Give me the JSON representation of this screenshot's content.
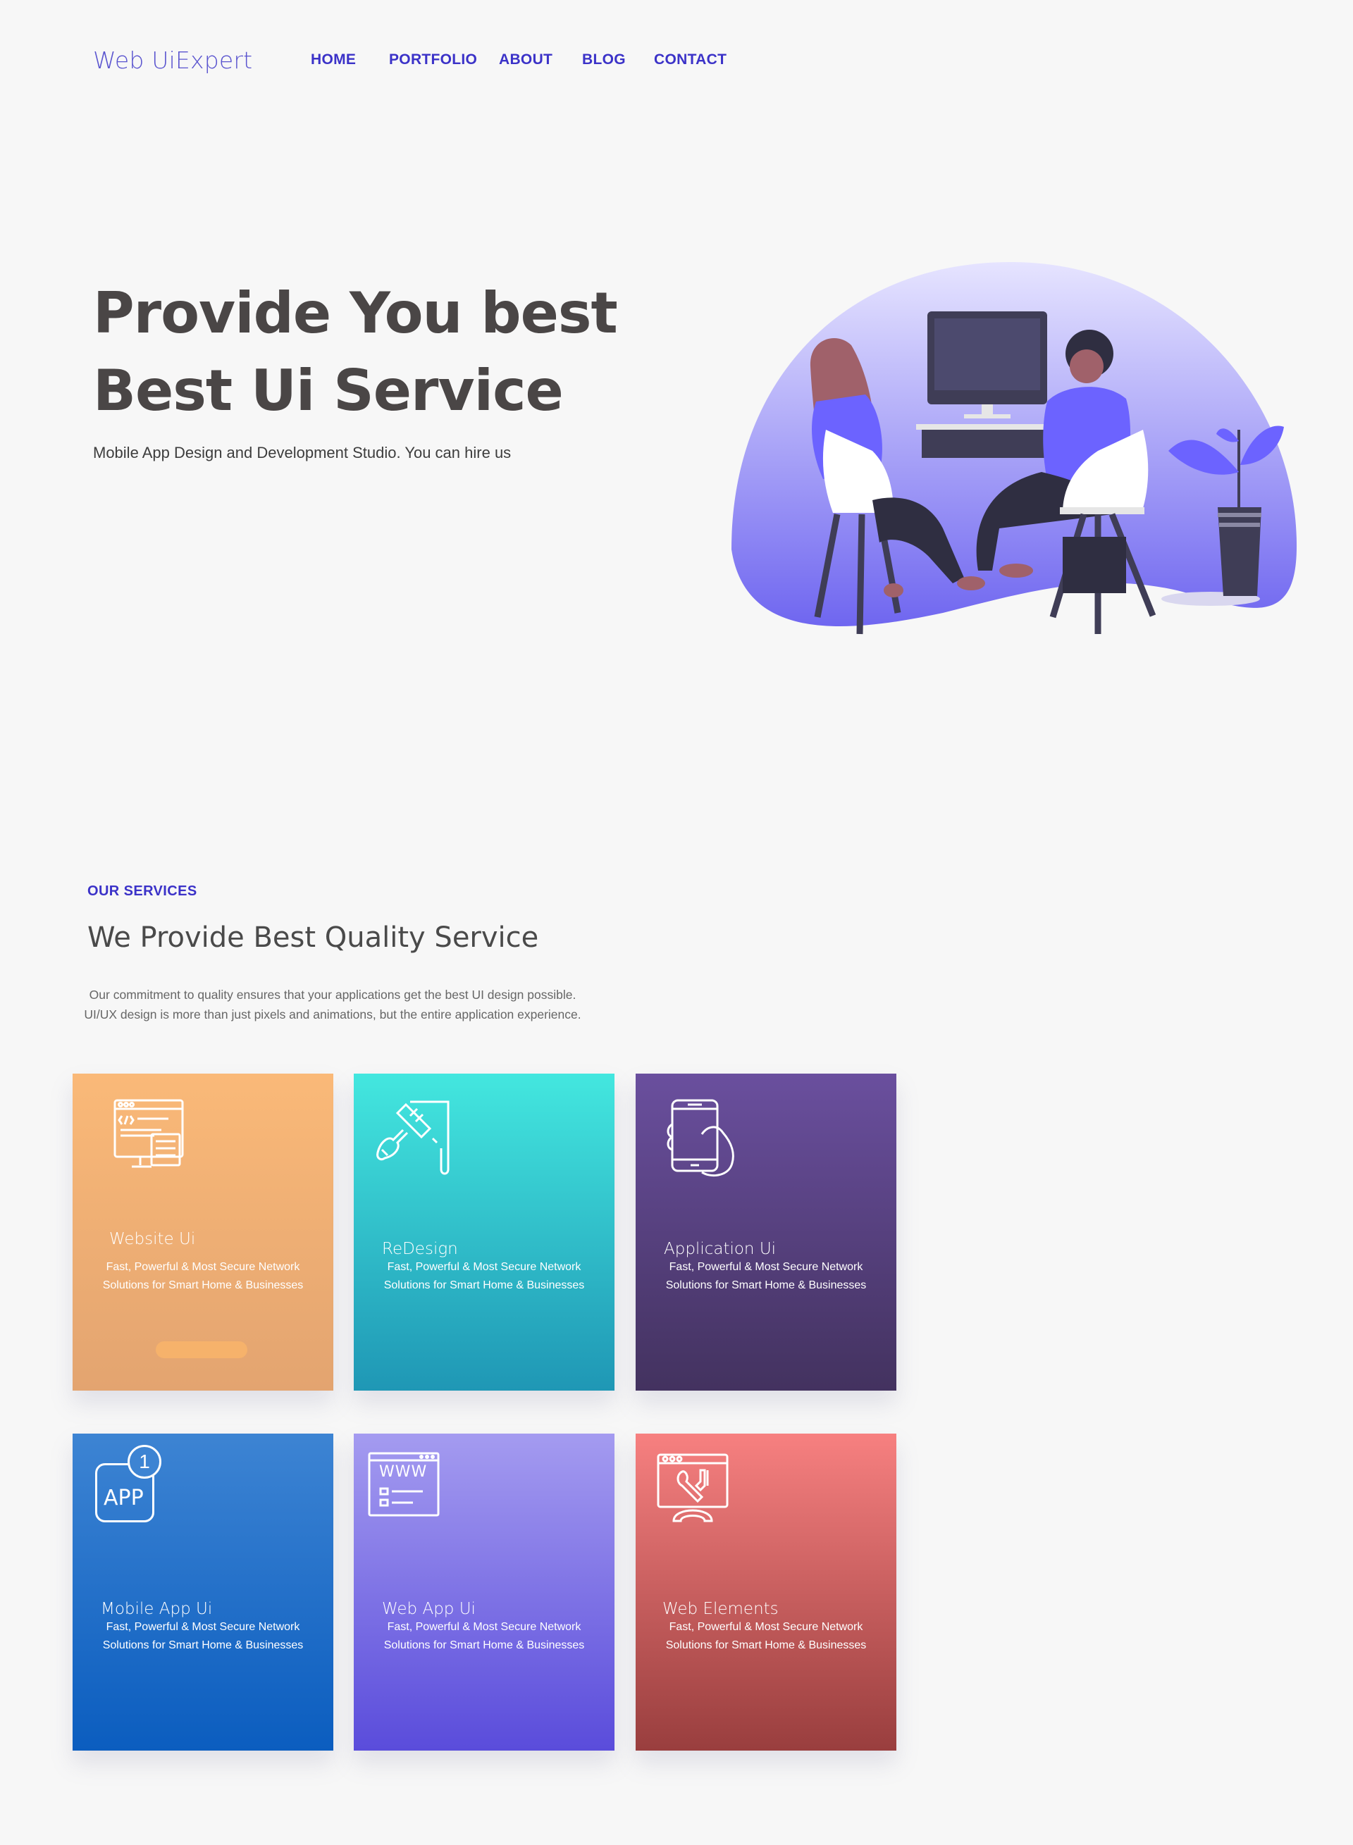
{
  "nav": {
    "logo": "Web UiExpert",
    "links": [
      "HOME",
      "PORTFOLIO",
      "ABOUT",
      "BLOG",
      "CONTACT"
    ]
  },
  "hero": {
    "title_line1": "Provide You best",
    "title_line2": "Best Ui Service",
    "subtitle": "Mobile App Design and Development Studio. You can hire us"
  },
  "services": {
    "tag": "OUR SERVICES",
    "title": "We Provide Best Quality Service",
    "description": "Our commitment to quality ensures that your applications get the best UI design possible. UI/UX design is more than just pixels and animations, but the entire application experience.",
    "cards": [
      {
        "title": "Website Ui",
        "desc_line1": "Fast, Powerful & Most Secure Network",
        "desc_line2": "Solutions for Smart Home & Businesses",
        "icon": "code-monitor-icon"
      },
      {
        "title": "ReDesign",
        "desc_line1": "Fast, Powerful & Most Secure Network",
        "desc_line2": "Solutions for Smart Home & Businesses",
        "icon": "paint-brush-icon"
      },
      {
        "title": "Application Ui",
        "desc_line1": "Fast, Powerful & Most Secure Network",
        "desc_line2": "Solutions for Smart Home & Businesses",
        "icon": "phone-hand-icon"
      },
      {
        "title": "Mobile App Ui",
        "desc_line1": "Fast, Powerful & Most Secure Network",
        "desc_line2": "Solutions for Smart Home & Businesses",
        "icon": "app-badge-icon",
        "badge_count": "1",
        "badge_label": "APP"
      },
      {
        "title": "Web App Ui",
        "desc_line1": "Fast, Powerful & Most Secure Network",
        "desc_line2": "Solutions for Smart Home & Businesses",
        "icon": "www-browser-icon",
        "icon_text": "WWW"
      },
      {
        "title": "Web Elements",
        "desc_line1": "Fast, Powerful & Most Secure Network",
        "desc_line2": "Solutions for Smart Home & Businesses",
        "icon": "browser-tools-icon"
      }
    ]
  },
  "colors": {
    "accent": "#3b32c8",
    "card1": "#fab978",
    "card2": "#43e7df",
    "card3": "#6a4f9e",
    "card4": "#3d84d3",
    "card5": "#a49bf0",
    "card6": "#f78080"
  }
}
